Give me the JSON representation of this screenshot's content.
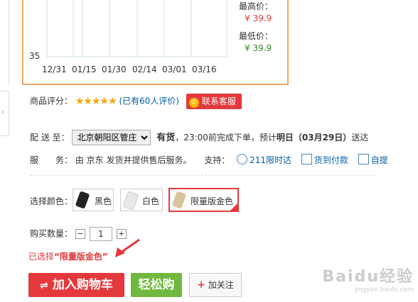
{
  "price_chart": {
    "y_tick": "35",
    "x_ticks": [
      "12/31",
      "01/15",
      "01/30",
      "02/14",
      "03/01",
      "03/16"
    ],
    "high_label": "最高价：",
    "high_value": "¥ 39.9",
    "low_label": "最低价：",
    "low_value": "¥ 39.9"
  },
  "rating": {
    "label": "商品评分：",
    "stars": "★★★★★",
    "count_text": "(已有60人评价)",
    "service_button": "联系客服"
  },
  "delivery": {
    "label": "配 送 至：",
    "region": "北京朝阳区管庄",
    "stock": "有货",
    "note1": "，23:00前完成下单，预计",
    "date": "明日（03月29日）",
    "note2": "送达"
  },
  "service": {
    "label": "服　　务：",
    "text": "由 京东 发货并提供售后服务。",
    "support_label": "支持：",
    "items": [
      "211限时达",
      "货到付款",
      "自提"
    ]
  },
  "color_select": {
    "label": "选择颜色：",
    "options": [
      "黑色",
      "白色",
      "限量版金色"
    ]
  },
  "quantity": {
    "label": "购买数量：",
    "minus": "−",
    "value": "1",
    "plus": "+"
  },
  "selected": {
    "prefix": "已选择",
    "value": "“限量版金色”"
  },
  "actions": {
    "cart_icon": "⇌",
    "cart": "加入购物车",
    "easy_buy": "轻松购",
    "follow_icon": "+",
    "follow": "加关注"
  },
  "watermark": {
    "brand": "Baidu经验",
    "url": "jingyan.baidu.com"
  },
  "colors": {
    "accent_red": "#e4393c",
    "green": "#70b83f",
    "link_blue": "#005ea7"
  }
}
